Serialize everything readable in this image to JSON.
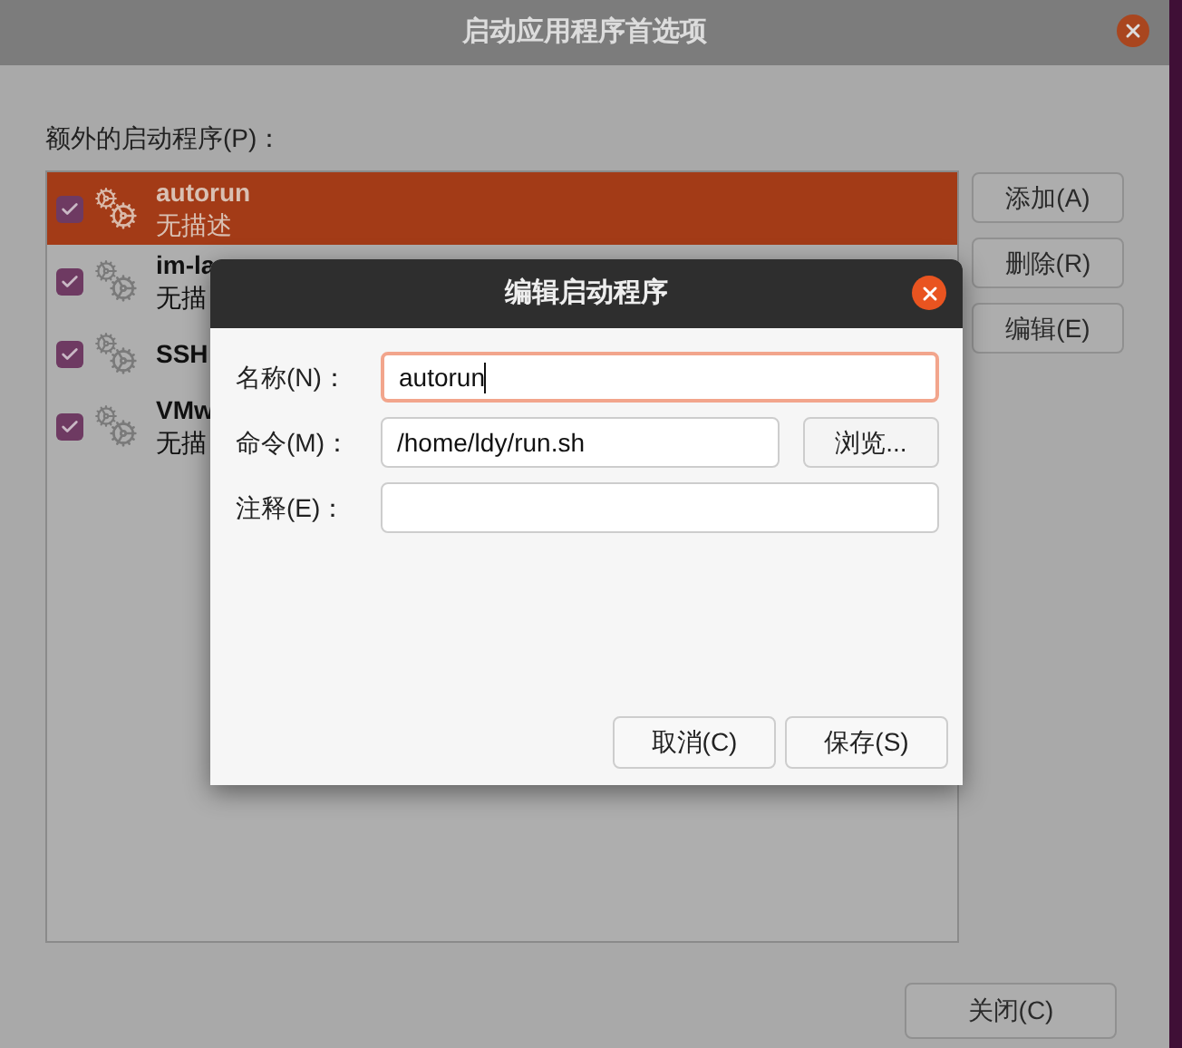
{
  "window": {
    "title": "启动应用程序首选项"
  },
  "list_label": "额外的启动程序(P)：",
  "programs": [
    {
      "name": "autorun",
      "description": "无描述",
      "checked": true,
      "selected": true
    },
    {
      "name": "im-la",
      "description": "无描",
      "checked": true,
      "selected": false
    },
    {
      "name": "SSH",
      "checked": true,
      "selected": false
    },
    {
      "name": "VMw",
      "description": "无描",
      "checked": true,
      "selected": false
    }
  ],
  "side_buttons": [
    "添加(A)",
    "删除(R)",
    "编辑(E)"
  ],
  "close_button": "关闭(C)",
  "dialog": {
    "title": "编辑启动程序",
    "fields": [
      {
        "label": "名称(N)：",
        "value": "autorun",
        "focused": true
      },
      {
        "label": "命令(M)：",
        "value": "/home/ldy/run.sh",
        "focused": false,
        "button": "浏览..."
      },
      {
        "label": "注释(E)：",
        "focused": false
      }
    ],
    "buttons": [
      "取消(C)",
      "保存(S)"
    ]
  }
}
